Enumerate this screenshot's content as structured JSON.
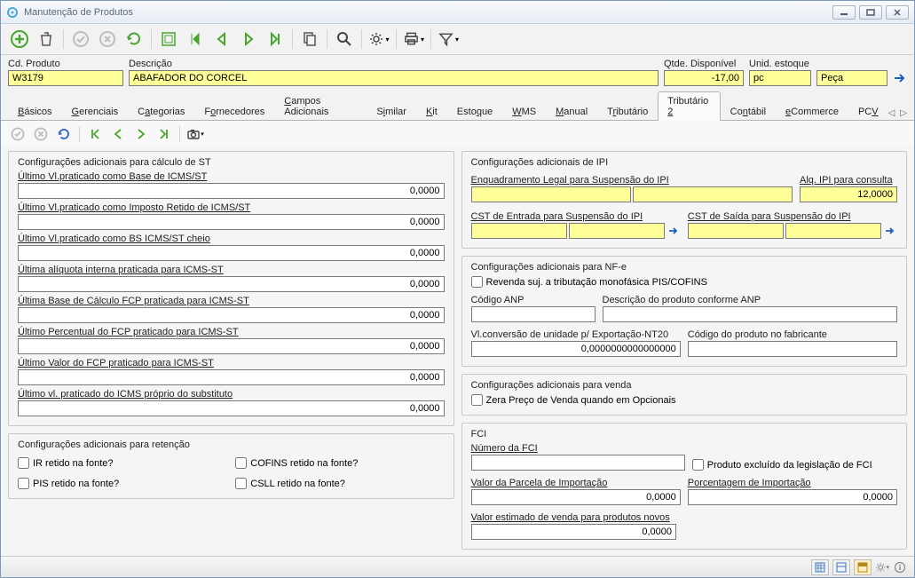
{
  "window": {
    "title": "Manutenção de Produtos"
  },
  "header": {
    "cd_produto_label": "Cd. Produto",
    "cd_produto": "W3179",
    "descricao_label": "Descrição",
    "descricao": "ABAFADOR DO CORCEL",
    "qtde_disponivel_label": "Qtde. Disponível",
    "qtde_disponivel": "-17,00",
    "unid_estoque_label": "Unid. estoque",
    "unid_estoque_code": "pc",
    "unid_estoque_desc": "Peça"
  },
  "tabs": [
    "Básicos",
    "Gerenciais",
    "Categorias",
    "Fornecedores",
    "Campos Adicionais",
    "Similar",
    "Kit",
    "Estoque",
    "WMS",
    "Manual",
    "Tributário",
    "Tributário 2",
    "Contábil",
    "eCommerce",
    "PCV"
  ],
  "st": {
    "title": "Configurações adicionais para cálculo de ST",
    "fields": [
      {
        "label": "Último Vl.praticado como Base de ICMS/ST",
        "value": "0,0000"
      },
      {
        "label": "Último Vl.praticado como Imposto Retido de ICMS/ST",
        "value": "0,0000"
      },
      {
        "label": "Último Vl.praticado como BS ICMS/ST cheio",
        "value": "0,0000"
      },
      {
        "label": "Última alíquota interna praticada para ICMS-ST",
        "value": "0,0000"
      },
      {
        "label": "Última Base de Cálculo FCP praticada para ICMS-ST",
        "value": "0,0000"
      },
      {
        "label": "Último Percentual do FCP praticado para ICMS-ST",
        "value": "0,0000"
      },
      {
        "label": "Último Valor do FCP praticado para ICMS-ST",
        "value": "0,0000"
      },
      {
        "label": "Último vl. praticado do ICMS próprio do substituto",
        "value": "0,0000"
      }
    ]
  },
  "retencao": {
    "title": "Configurações adicionais para retenção",
    "items": [
      "IR retido na fonte?",
      "COFINS retido na fonte?",
      "PIS retido na fonte?",
      "CSLL retido na fonte?"
    ]
  },
  "ipi": {
    "title": "Configurações adicionais de IPI",
    "enq_label": "Enquadramento Legal para Suspensão do IPI",
    "alq_label": "Alq. IPI para consulta",
    "alq": "12,0000",
    "cst_ent_label": "CST de Entrada para Suspensão do IPI",
    "cst_sai_label": "CST de Saída para Suspensão do IPI"
  },
  "nfe": {
    "title": "Configurações adicionais para NF-e",
    "mono_label": "Revenda suj. a tributação monofásica PIS/COFINS",
    "anp_label": "Código ANP",
    "anp_desc_label": "Descrição do produto conforme ANP",
    "conv_label": "Vl.conversão de unidade p/ Exportação-NT20",
    "conv": "0,0000000000000000",
    "fabr_label": "Código do produto no fabricante"
  },
  "venda": {
    "title": "Configurações adicionais para venda",
    "zera_label": "Zera Preço de Venda quando em Opcionais"
  },
  "fci": {
    "title": "FCI",
    "num_label": "Número da FCI",
    "excl_label": "Produto excluído da legislação de FCI",
    "parcela_label": "Valor da Parcela de Importação",
    "parcela": "0,0000",
    "porc_label": "Porcentagem de Importação",
    "porc": "0,0000",
    "estimado_label": "Valor estimado de venda para produtos novos",
    "estimado": "0,0000"
  }
}
